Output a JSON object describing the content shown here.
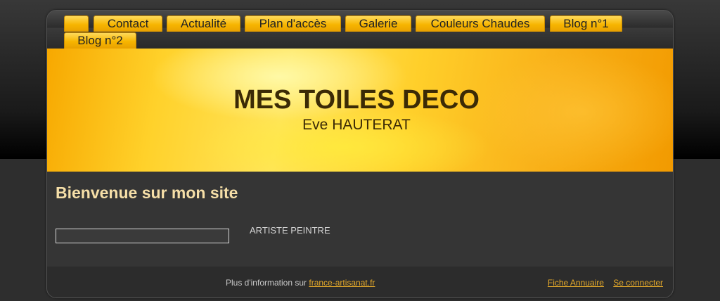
{
  "nav": {
    "items": [
      {
        "label": ""
      },
      {
        "label": "Contact"
      },
      {
        "label": "Actualité"
      },
      {
        "label": "Plan d'accès"
      },
      {
        "label": "Galerie"
      },
      {
        "label": "Couleurs Chaudes"
      },
      {
        "label": "Blog n°1"
      },
      {
        "label": "Blog n°2"
      }
    ]
  },
  "header": {
    "title": "MES TOILES DECO",
    "subtitle": "Eve HAUTERAT"
  },
  "main": {
    "heading": "Bienvenue sur mon site",
    "input_value": "",
    "tagline": "ARTISTE PEINTRE"
  },
  "footer": {
    "info_prefix": "Plus d'information sur",
    "info_link": "france-artisanat.fr",
    "link_directory": "Fiche Annuaire",
    "link_login": "Se connecter"
  },
  "colors": {
    "accent": "#f7b500",
    "heading": "#f6dfa8",
    "link": "#e3a82a"
  }
}
